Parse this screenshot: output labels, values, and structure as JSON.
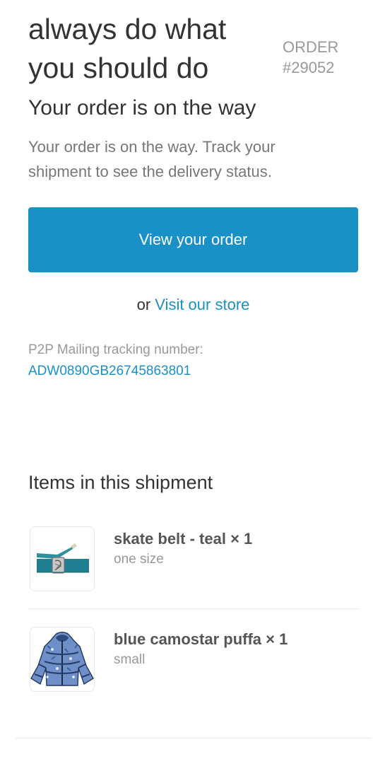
{
  "header": {
    "brand_text": "always do what you should do",
    "order_label": "ORDER",
    "order_number": "#29052"
  },
  "notification": {
    "title": "Your order is on the way",
    "message": "Your order is on the way. Track your shipment to see the delivery status.",
    "primary_button": "View your order",
    "secondary_prefix": "or",
    "secondary_link": "Visit our store"
  },
  "tracking": {
    "label": "P2P Mailing tracking number:",
    "number": "ADW0890GB26745863801"
  },
  "shipment": {
    "heading": "Items in this shipment",
    "items": [
      {
        "title": "skate belt - teal × 1",
        "variant": "one size",
        "image": "teal-belt-product-image"
      },
      {
        "title": "blue camostar puffa × 1",
        "variant": "small",
        "image": "blue-puffer-jacket-product-image"
      }
    ]
  },
  "colors": {
    "accent": "#1990c6",
    "primary_text": "#333333",
    "muted_text": "#999999",
    "divider": "#e5e5e5"
  }
}
